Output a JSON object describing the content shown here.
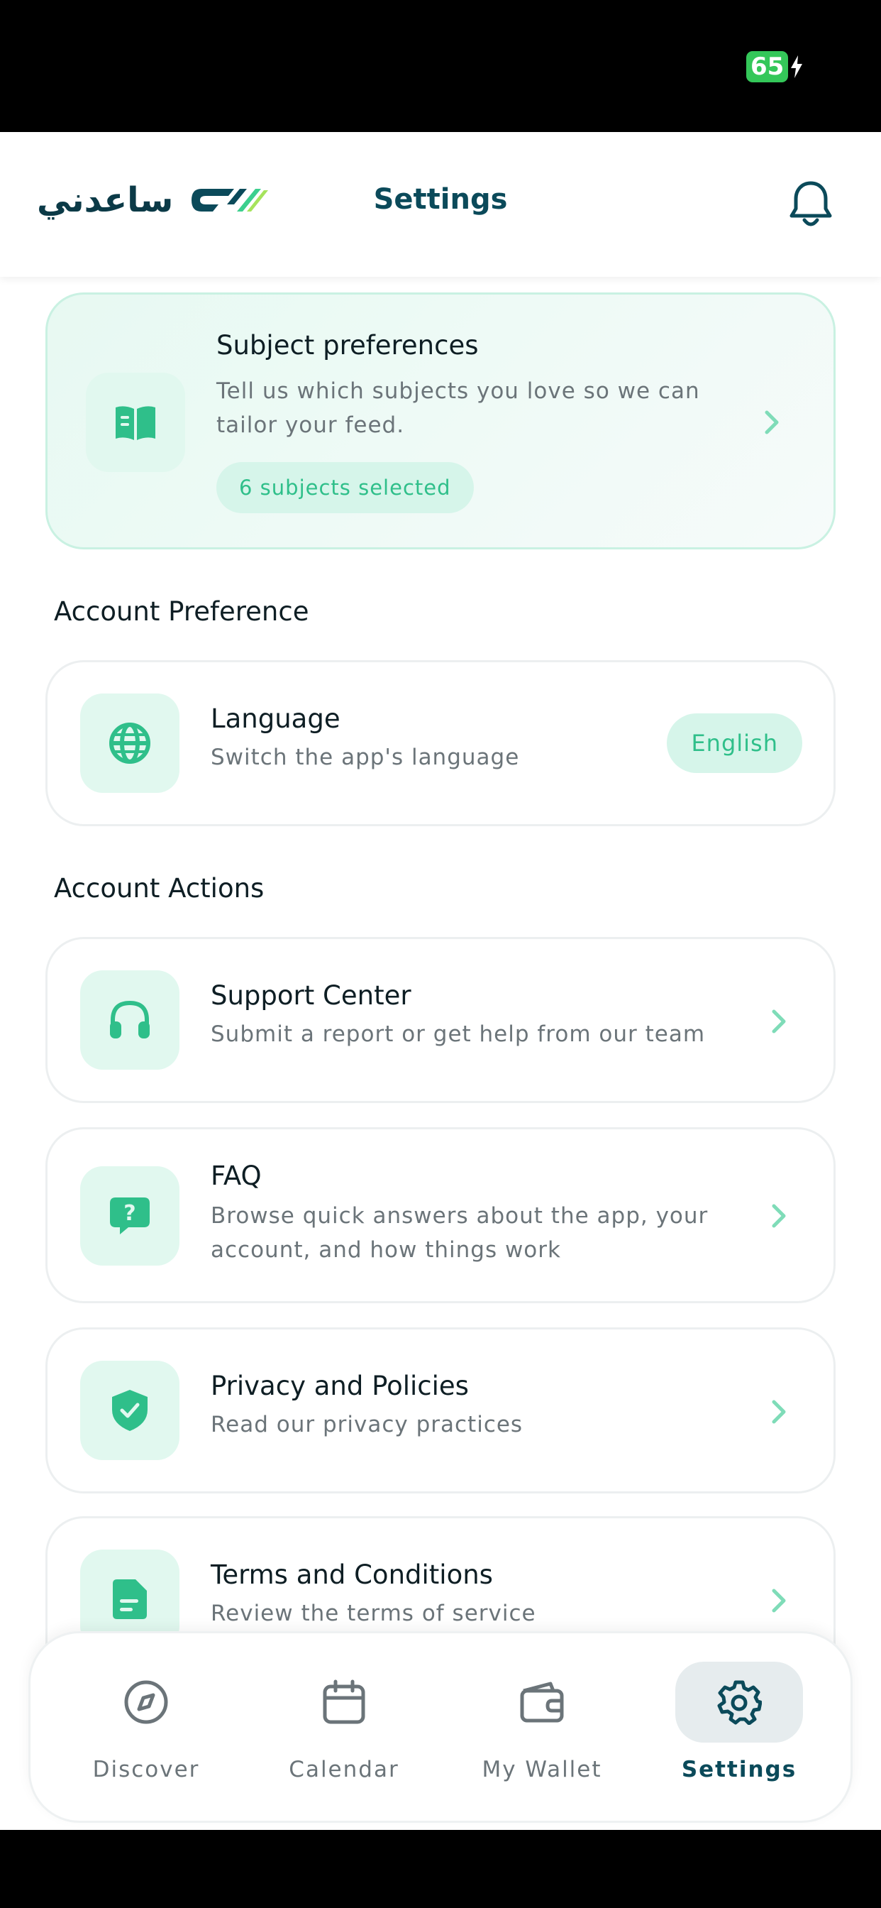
{
  "status_bar": {
    "battery_level": "65"
  },
  "header": {
    "logo_text": "ساعدني",
    "title": "Settings",
    "notification_icon": "bell-icon"
  },
  "subject_card": {
    "title": "Subject preferences",
    "description": "Tell us which subjects you love so we can tailor your feed.",
    "badge": "6 subjects selected",
    "icon": "book-open-icon"
  },
  "account_preference": {
    "section_title": "Account Preference",
    "language": {
      "title": "Language",
      "description": "Switch the app's language",
      "value": "English",
      "icon": "globe-icon"
    }
  },
  "account_actions": {
    "section_title": "Account Actions",
    "items": [
      {
        "title": "Support Center",
        "description": "Submit a report or get help from our team",
        "icon": "headset-icon"
      },
      {
        "title": "FAQ",
        "description": "Browse quick answers about the app, your account, and how things work",
        "icon": "question-bubble-icon"
      },
      {
        "title": "Privacy and Policies",
        "description": "Read our privacy practices",
        "icon": "shield-check-icon"
      },
      {
        "title": "Terms and Conditions",
        "description": "Review the terms of service",
        "icon": "document-icon"
      }
    ]
  },
  "tabbar": {
    "tabs": [
      {
        "label": "Discover",
        "icon": "compass-icon",
        "active": false
      },
      {
        "label": "Calendar",
        "icon": "calendar-icon",
        "active": false
      },
      {
        "label": "My Wallet",
        "icon": "wallet-icon",
        "active": false
      },
      {
        "label": "Settings",
        "icon": "gear-icon",
        "active": true
      }
    ]
  },
  "colors": {
    "accent": "#2fbf8a",
    "accent_light": "#d6f5ea",
    "primary_dark": "#0b4a5a",
    "text_muted": "#6b7479"
  }
}
